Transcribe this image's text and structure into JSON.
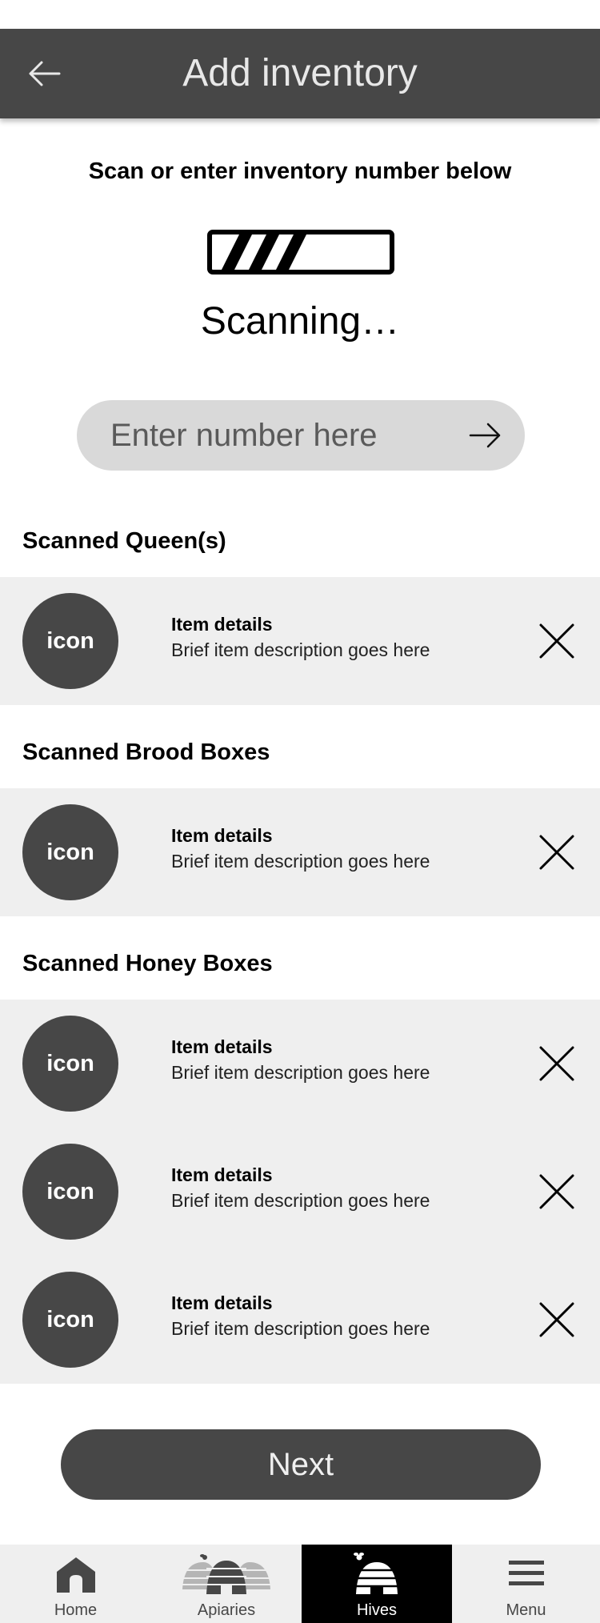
{
  "header": {
    "title": "Add inventory",
    "back_icon": "arrow-left-icon"
  },
  "scan": {
    "instruction": "Scan or enter inventory number below",
    "status": "Scanning…",
    "icon": "barcode-scan-progress-icon"
  },
  "number_input": {
    "placeholder": "Enter number here",
    "value": "",
    "submit_icon": "arrow-right-icon"
  },
  "sections": {
    "queens": {
      "title": "Scanned Queen(s)",
      "items": [
        {
          "icon_label": "icon",
          "title": "Item details",
          "description": "Brief item description goes here"
        }
      ]
    },
    "brood": {
      "title": "Scanned Brood Boxes",
      "items": [
        {
          "icon_label": "icon",
          "title": "Item details",
          "description": "Brief item description goes here"
        }
      ]
    },
    "honey": {
      "title": "Scanned Honey Boxes",
      "items": [
        {
          "icon_label": "icon",
          "title": "Item details",
          "description": "Brief item description goes here"
        },
        {
          "icon_label": "icon",
          "title": "Item details",
          "description": "Brief item description goes here"
        },
        {
          "icon_label": "icon",
          "title": "Item details",
          "description": "Brief item description goes here"
        }
      ]
    }
  },
  "next_button": {
    "label": "Next"
  },
  "bottom_nav": {
    "items": [
      {
        "label": "Home",
        "icon": "home-icon",
        "active": false
      },
      {
        "label": "Apiaries",
        "icon": "apiaries-beehives-icon",
        "active": false
      },
      {
        "label": "Hives",
        "icon": "beehive-icon",
        "active": true
      },
      {
        "label": "Menu",
        "icon": "hamburger-menu-icon",
        "active": false
      }
    ]
  },
  "colors": {
    "header_bg": "#474747",
    "row_bg": "#efefef",
    "nav_bg": "#efefef",
    "nav_active_bg": "#000000",
    "input_bg": "#d9d9d9"
  }
}
